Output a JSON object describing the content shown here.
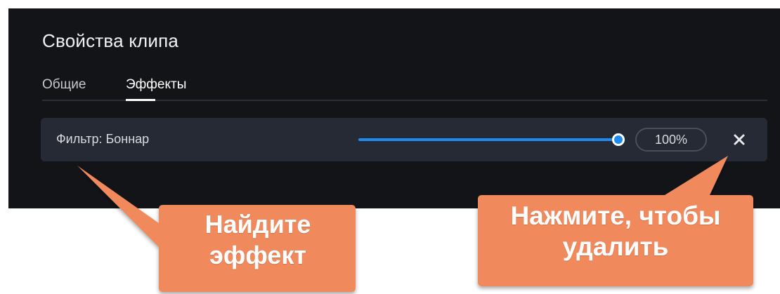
{
  "panel": {
    "title": "Свойства клипа",
    "tabs": [
      {
        "label": "Общие",
        "active": false
      },
      {
        "label": "Эффекты",
        "active": true
      }
    ]
  },
  "effect": {
    "name": "Фильтр: Боннар",
    "intensity_percent": 100,
    "value_label": "100%",
    "remove_icon": "close-icon"
  },
  "callouts": {
    "find": {
      "line1": "Найдите",
      "line2": "эффект"
    },
    "remove": {
      "line1": "Нажмите, чтобы",
      "line2": "удалить"
    }
  },
  "colors": {
    "panel_bg": "#121418",
    "row_bg": "#252a35",
    "accent": "#1d8bf0",
    "callout": "#f08a5d"
  }
}
